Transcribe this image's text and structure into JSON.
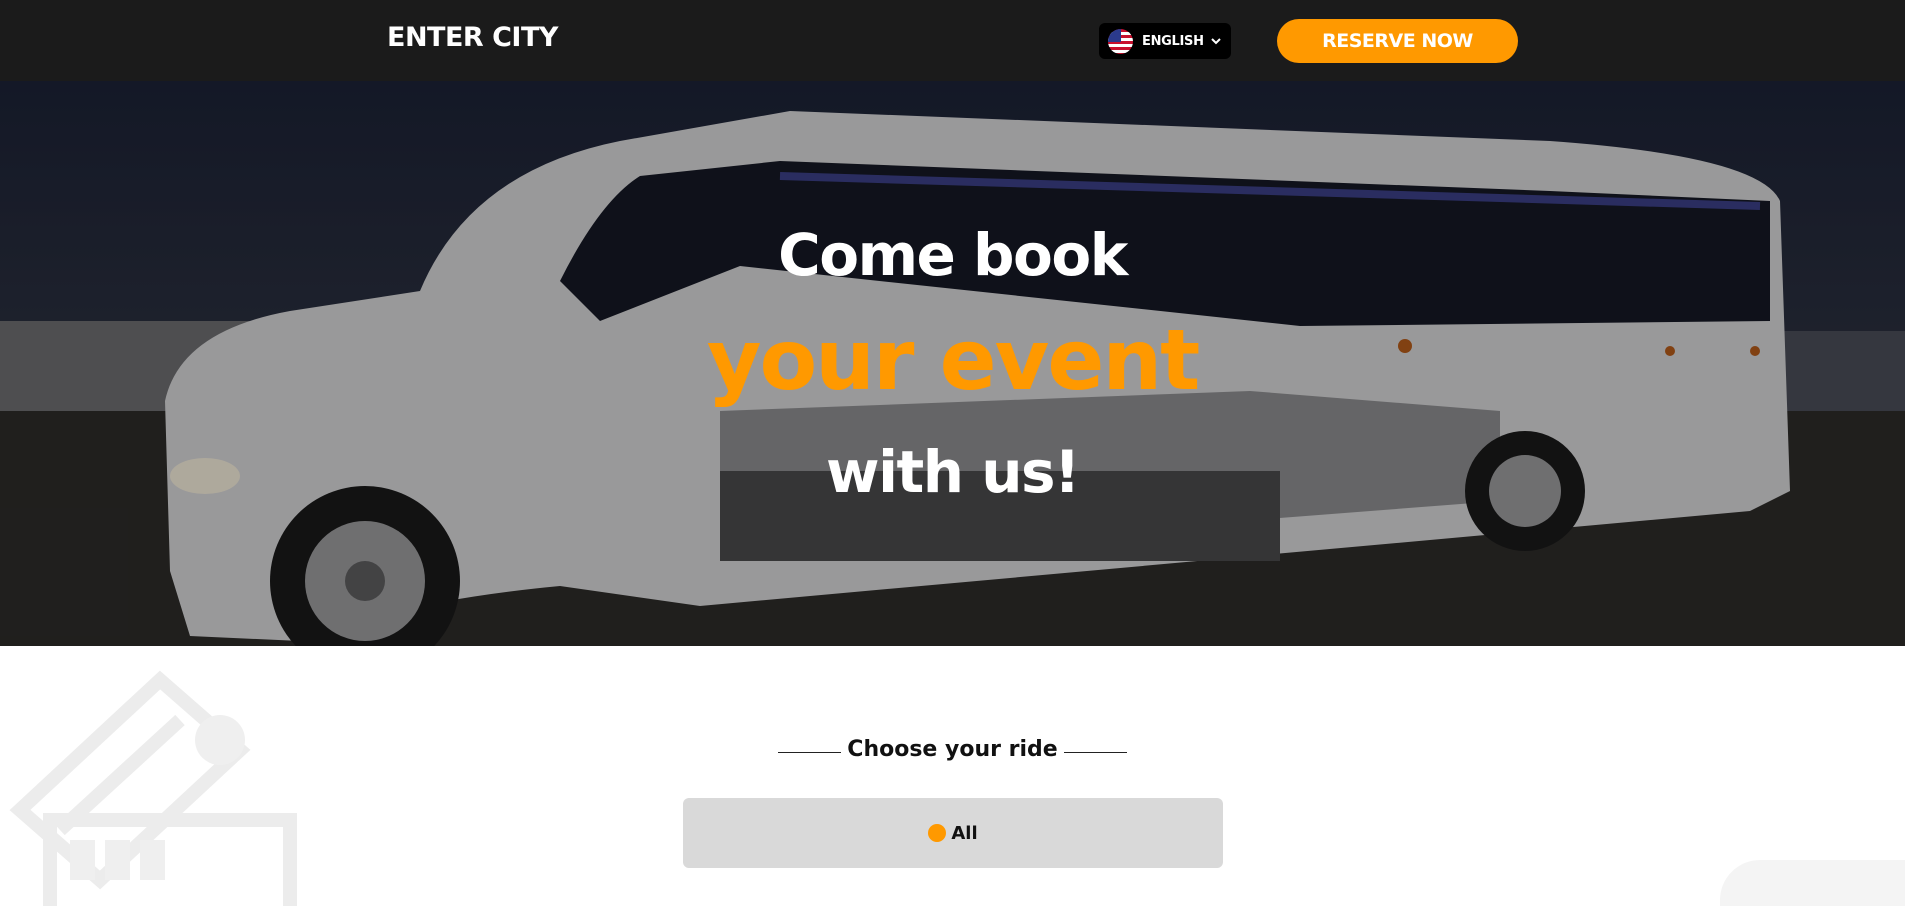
{
  "header": {
    "brand": "ENTER CITY",
    "language": {
      "label": "ENGLISH",
      "flag_icon": "us-flag-icon"
    },
    "reserve_label": "RESERVE NOW"
  },
  "hero": {
    "line1": "Come book",
    "line2": "your event",
    "line3": "with us!",
    "background": "white coach bus at night"
  },
  "section": {
    "title": "Choose your ride",
    "filters": [
      {
        "label": "All",
        "selected": true
      }
    ]
  },
  "colors": {
    "accent": "#ff9900",
    "header_bg": "#1b1b1b",
    "filter_bg": "#d9d9d9"
  }
}
